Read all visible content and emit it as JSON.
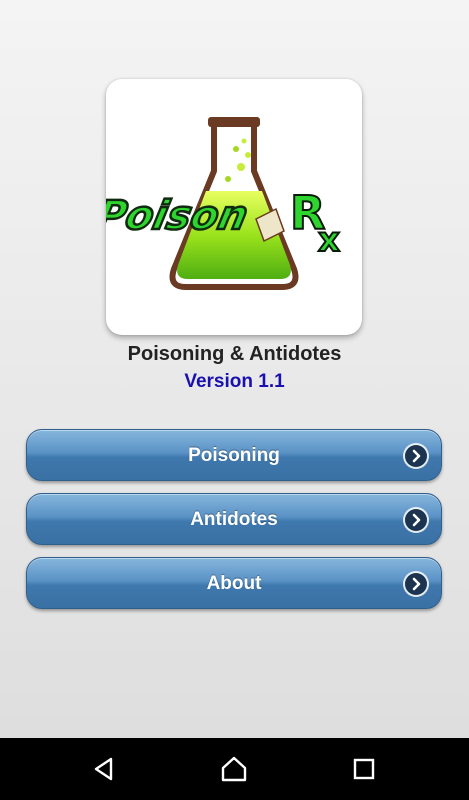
{
  "app": {
    "title": "Poisoning & Antidotes",
    "version": "Version 1.1",
    "logo_text": "PoisonRx"
  },
  "menu": {
    "items": [
      {
        "label": "Poisoning",
        "icon": "chevron-right-circle-icon"
      },
      {
        "label": "Antidotes",
        "icon": "chevron-right-circle-icon"
      },
      {
        "label": "About",
        "icon": "chevron-right-circle-icon"
      }
    ]
  },
  "navbar": {
    "back_icon": "back-triangle-icon",
    "home_icon": "home-icon",
    "recents_icon": "recents-square-icon"
  },
  "colors": {
    "button_blue": "#4a84b9",
    "version_text": "#1a10b0",
    "logo_green": "#2fd52f",
    "navbar": "#000000"
  }
}
